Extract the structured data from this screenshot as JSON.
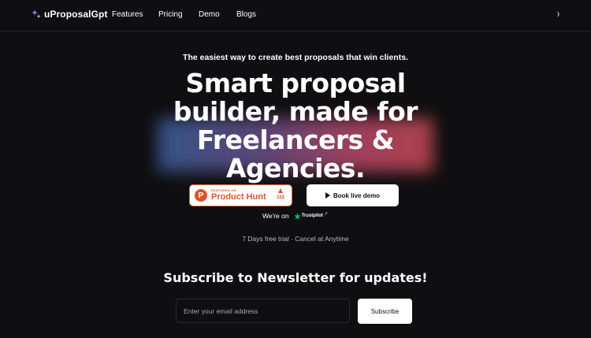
{
  "nav": {
    "brand": "uProposalGpt",
    "links": [
      {
        "label": "Features"
      },
      {
        "label": "Pricing"
      },
      {
        "label": "Demo"
      },
      {
        "label": "Blogs"
      }
    ]
  },
  "hero": {
    "tagline": "The easiest way to create best proposals that win clients.",
    "title_lines": [
      "Smart proposal",
      "builder, made for",
      "Freelancers &",
      "Agencies."
    ]
  },
  "product_hunt": {
    "logo_letter": "P",
    "featured": "FEATURED ON",
    "name": "Product Hunt",
    "votes": "102",
    "accent": "#da552f"
  },
  "demo_button": {
    "label": "Book live demo"
  },
  "trustpilot": {
    "prefix": "We're on",
    "name": "Trustpilot",
    "star_color": "#00b67a"
  },
  "trial_text": "7 Days free trial · Cancel at Anytime",
  "newsletter": {
    "title": "Subscribe to Newsletter for updates!",
    "placeholder": "Enter your email address",
    "button": "Subscribe"
  },
  "colors": {
    "background": "#0f0e10",
    "brand_purple": "#a86bff"
  }
}
